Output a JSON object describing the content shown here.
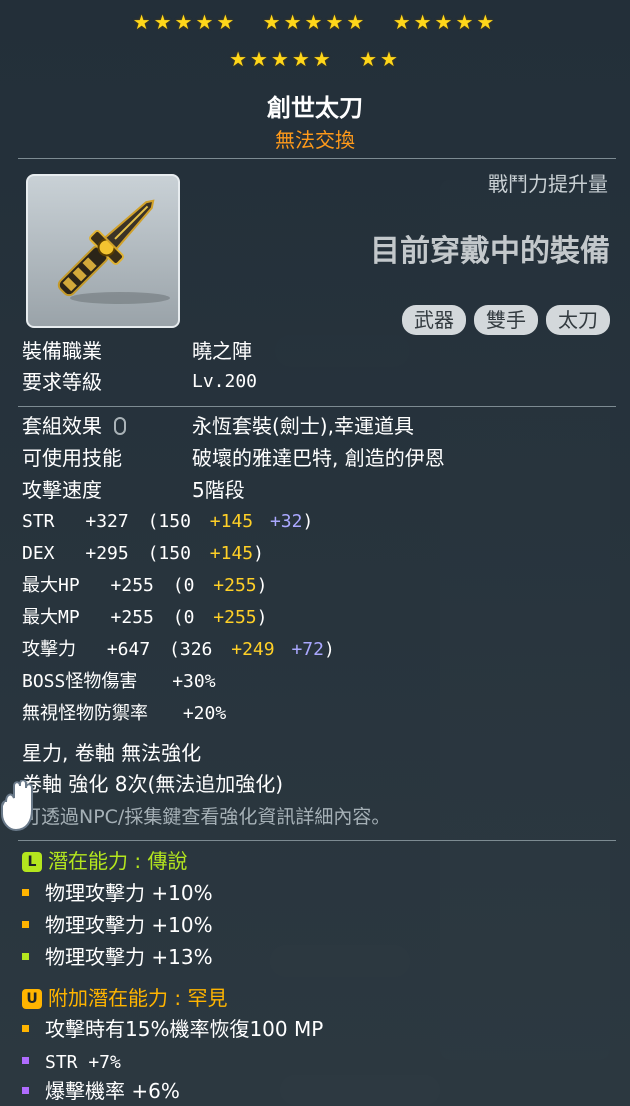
{
  "stars": {
    "group1": "★★★★★",
    "group2": "★★★★★",
    "group3": "★★★★★",
    "group4": "★★★★★",
    "group5": "★★"
  },
  "item": {
    "name": "創世太刀",
    "trade_status": "無法交換",
    "power_label": "戰鬥力提升量",
    "equipped_label": "目前穿戴中的裝備",
    "tags": [
      "武器",
      "雙手",
      "太刀"
    ]
  },
  "requirements": [
    {
      "label": "裝備職業",
      "value": "曉之陣"
    },
    {
      "label": "要求等級",
      "value": "Lv.200"
    }
  ],
  "info": [
    {
      "label": "套組效果",
      "value": "永恆套裝(劍士),幸運道具"
    },
    {
      "label": "可使用技能",
      "value": "破壞的雅達巴特, 創造的伊恩"
    },
    {
      "label": "攻擊速度",
      "value": "5階段"
    }
  ],
  "stats": {
    "str": {
      "label": "STR",
      "total": "+327",
      "open": "(150",
      "bonus1": "+145",
      "bonus2": "+32",
      "close": ")"
    },
    "dex": {
      "label": "DEX",
      "total": "+295",
      "open": "(150",
      "bonus1": "+145",
      "close": ")"
    },
    "hp": {
      "label": "最大HP",
      "total": "+255",
      "open": "(0",
      "bonus1": "+255",
      "close": ")"
    },
    "mp": {
      "label": "最大MP",
      "total": "+255",
      "open": "(0",
      "bonus1": "+255",
      "close": ")"
    },
    "atk": {
      "label": "攻擊力",
      "total": "+647",
      "open": "(326",
      "bonus1": "+249",
      "bonus2": "+72",
      "close": ")"
    },
    "boss": {
      "label": "BOSS怪物傷害",
      "total": "+30%"
    },
    "ied": {
      "label": "無視怪物防禦率",
      "total": "+20%"
    }
  },
  "enhance": {
    "line1": "星力, 卷軸 無法強化",
    "line2": "卷軸 強化 8次(無法追加強化)",
    "hint": "可透過NPC/採集鍵查看強化資訊詳細內容。"
  },
  "potential": {
    "badge": "L",
    "title": "潛在能力 : 傳說",
    "lines": [
      "物理攻擊力 +10%",
      "物理攻擊力 +10%",
      "物理攻擊力 +13%"
    ]
  },
  "additional": {
    "badge": "U",
    "title": "附加潛在能力 : 罕見",
    "lines": [
      "攻擊時有15%機率恢復100 MP",
      "STR +7%",
      "爆擊機率 +6%"
    ]
  },
  "colors": {
    "star": "#ffd71a",
    "untradable": "#ff9a1a",
    "bonus_yellow": "#ffd027",
    "bonus_purple": "#aaa8ff",
    "legendary": "#b4e61e",
    "unique": "#ffb400",
    "rare_dot": "#b06cff"
  }
}
